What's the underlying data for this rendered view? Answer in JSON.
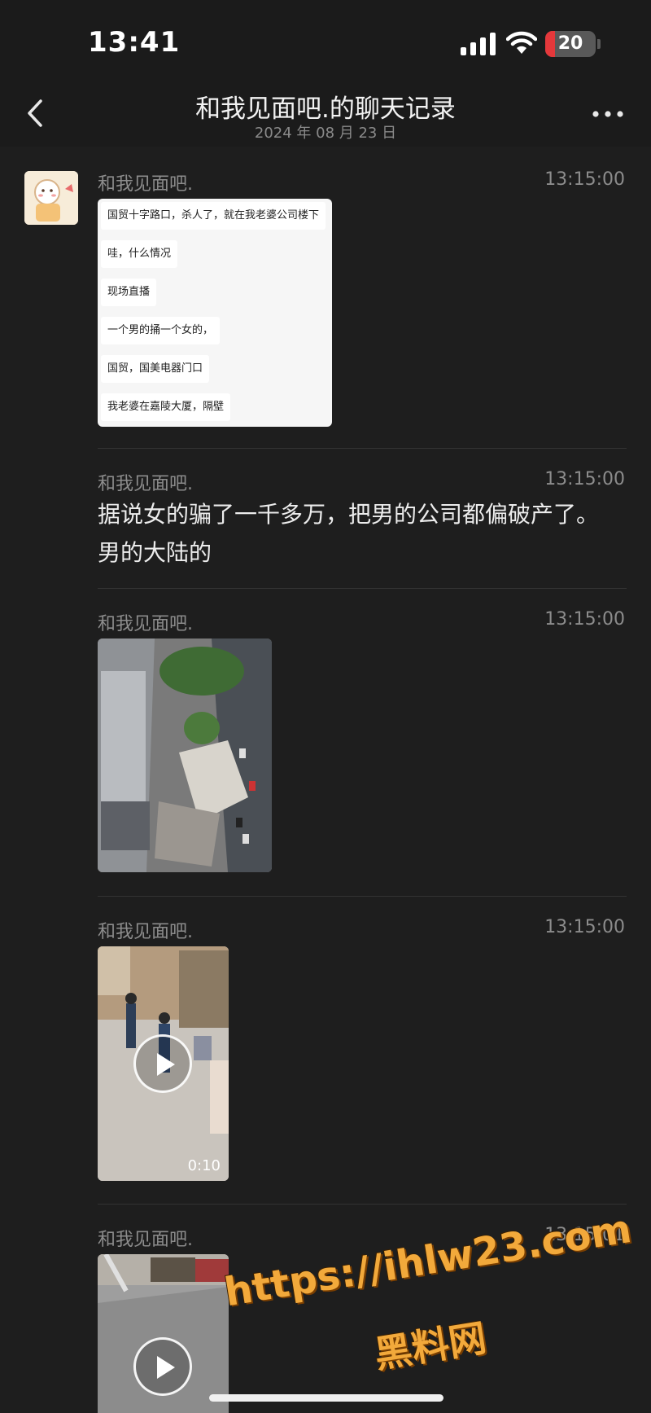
{
  "status_bar": {
    "time": "13:41",
    "battery_level": "20",
    "battery_fraction": 0.2,
    "battery_color": "#e5383b"
  },
  "nav": {
    "title": "和我见面吧.的聊天记录",
    "date": "2024 年 08 月 23 日",
    "back_icon": "chevron-left-icon",
    "more_icon": "more-dots-icon"
  },
  "messages": [
    {
      "sender": "和我见面吧.",
      "time": "13:15:00",
      "type": "forwarded-chat",
      "lines": [
        "国贸十字路口，杀人了，就在我老婆公司楼下",
        "哇，什么情况",
        "现场直播",
        "一个男的捅一个女的，",
        "国贸，国美电器门口",
        "我老婆在嘉陵大厦，隔壁"
      ]
    },
    {
      "sender": "和我见面吧.",
      "time": "13:15:00",
      "type": "text",
      "text": "据说女的骗了一千多万，把男的公司都偏破产了。男的大陆的"
    },
    {
      "sender": "和我见面吧.",
      "time": "13:15:00",
      "type": "image"
    },
    {
      "sender": "和我见面吧.",
      "time": "13:15:00",
      "type": "video",
      "duration": "0:10"
    },
    {
      "sender": "和我见面吧.",
      "time": "13:15:01",
      "type": "video"
    }
  ],
  "watermark": {
    "url": "https://ihlw23.com",
    "name": "黑料网"
  },
  "colors": {
    "background": "#1e1e1e",
    "watermark": "#f2a93b"
  }
}
